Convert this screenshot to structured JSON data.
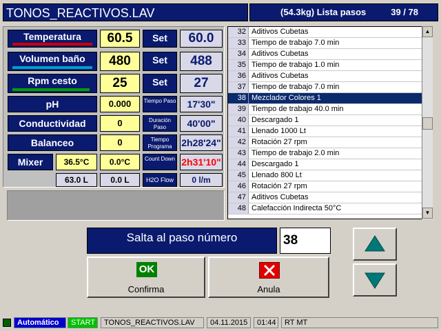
{
  "title": {
    "file": "TONOS_REACTIVOS.LAV",
    "info": "(54.3kg) Lista pasos",
    "steps": "39 / 78"
  },
  "sensors": {
    "temperatura": {
      "label": "Temperatura",
      "value": "60.5",
      "set_label": "Set",
      "set_value": "60.0",
      "bar_color": "#cc0000"
    },
    "volumen": {
      "label": "Volumen baño",
      "value": "480",
      "set_label": "Set",
      "set_value": "488",
      "bar_color": "#00a0c8"
    },
    "rpm": {
      "label": "Rpm cesto",
      "value": "25",
      "set_label": "Set",
      "set_value": "27",
      "bar_color": "#00a000"
    },
    "ph": {
      "label": "pH",
      "value": "0.000",
      "side_label": "Tiempo Paso",
      "side_value": "17'30\""
    },
    "conductividad": {
      "label": "Conductividad",
      "value": "0",
      "side_label": "Duración Paso",
      "side_value": "40'00\""
    },
    "balanceo": {
      "label": "Balanceo",
      "value": "0",
      "side_label": "Tiempo Programa",
      "side_value": "2h28'24\""
    },
    "mixer": {
      "label": "Mixer",
      "value1": "36.5°C",
      "value2": "0.0°C",
      "value3": "63.0 L",
      "value4": "0.0 L",
      "side_label": "Count Down",
      "side_value": "2h31'10\"",
      "side_color": "#ff0000"
    },
    "h2o": {
      "label": "H2O Flow",
      "value": "0 l/m"
    }
  },
  "steps": [
    {
      "num": "32",
      "text": "Aditivos Cubetas"
    },
    {
      "num": "33",
      "text": "Tiempo de trabajo 7.0 min"
    },
    {
      "num": "34",
      "text": "Aditivos Cubetas"
    },
    {
      "num": "35",
      "text": "Tiempo de trabajo 1.0 min"
    },
    {
      "num": "36",
      "text": "Aditivos Cubetas"
    },
    {
      "num": "37",
      "text": "Tiempo de trabajo 7.0 min"
    },
    {
      "num": "38",
      "text": "Mezclador Colores 1"
    },
    {
      "num": "39",
      "text": "Tiempo de trabajo 40.0 min"
    },
    {
      "num": "40",
      "text": "Descargado 1"
    },
    {
      "num": "41",
      "text": "Llenado 1000 Lt"
    },
    {
      "num": "42",
      "text": "Rotación 27 rpm"
    },
    {
      "num": "43",
      "text": "Tiempo de trabajo 2.0 min"
    },
    {
      "num": "44",
      "text": "Descargado 1"
    },
    {
      "num": "45",
      "text": "Llenado 800 Lt"
    },
    {
      "num": "46",
      "text": "Rotación 27 rpm"
    },
    {
      "num": "47",
      "text": "Aditivos Cubetas"
    },
    {
      "num": "48",
      "text": "Calefacción Indirecta 50°C"
    }
  ],
  "jump": {
    "label": "Salta al paso número",
    "value": "38"
  },
  "buttons": {
    "ok_badge": "OK",
    "ok_label": "Confirma",
    "cancel_label": "Anula"
  },
  "status": {
    "mode": "Automático",
    "state": "START",
    "file": "TONOS_REACTIVOS.LAV",
    "date": "04.11.2015",
    "time": "01:44",
    "rt": "RT MT"
  }
}
